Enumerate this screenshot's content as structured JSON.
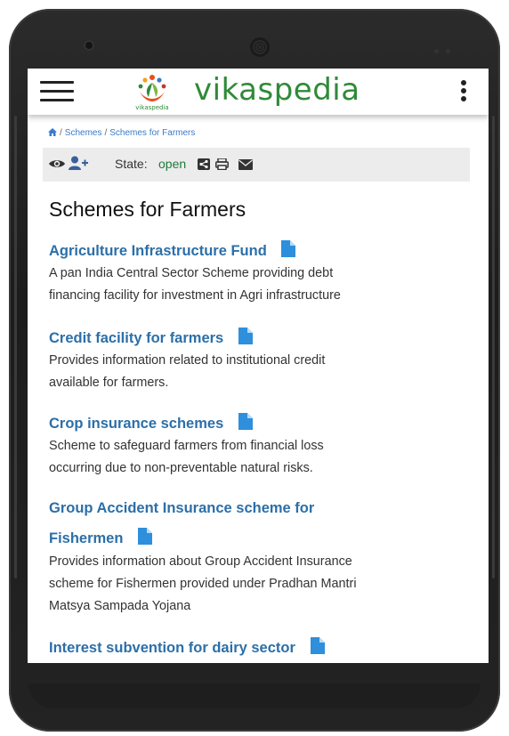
{
  "app": {
    "brand": "vikaspedia",
    "logo_text": "vikaspedia"
  },
  "breadcrumb": {
    "items": [
      "Schemes",
      "Schemes for Farmers"
    ]
  },
  "toolbar": {
    "state_label": "State:",
    "state_value": "open",
    "icons": [
      "eye-icon",
      "user-plus-icon",
      "share-icon",
      "print-icon",
      "mail-icon"
    ]
  },
  "page": {
    "title": "Schemes for Farmers"
  },
  "schemes": [
    {
      "title": "Agriculture Infrastructure Fund",
      "desc_lines": [
        "A pan India Central Sector Scheme providing debt",
        "financing facility for investment in Agri infrastructure"
      ]
    },
    {
      "title": "Credit facility for farmers",
      "desc_lines": [
        "Provides information related to institutional credit",
        "available for farmers."
      ]
    },
    {
      "title": "Crop insurance schemes",
      "desc_lines": [
        "Scheme to safeguard farmers from financial loss",
        "occurring due to non-preventable natural risks."
      ]
    },
    {
      "title_lines": [
        "Group Accident Insurance scheme for",
        "Fishermen"
      ],
      "desc_lines": [
        "Provides information about Group Accident Insurance",
        "scheme for Fishermen provided under Pradhan Mantri",
        "Matsya Sampada Yojana"
      ]
    },
    {
      "title": "Interest subvention for dairy sector"
    }
  ],
  "colors": {
    "brand_green": "#2f8a39",
    "link_blue": "#2c6fa8",
    "state_green": "#1f7a3a",
    "doc_icon_blue": "#2e8fdc"
  }
}
